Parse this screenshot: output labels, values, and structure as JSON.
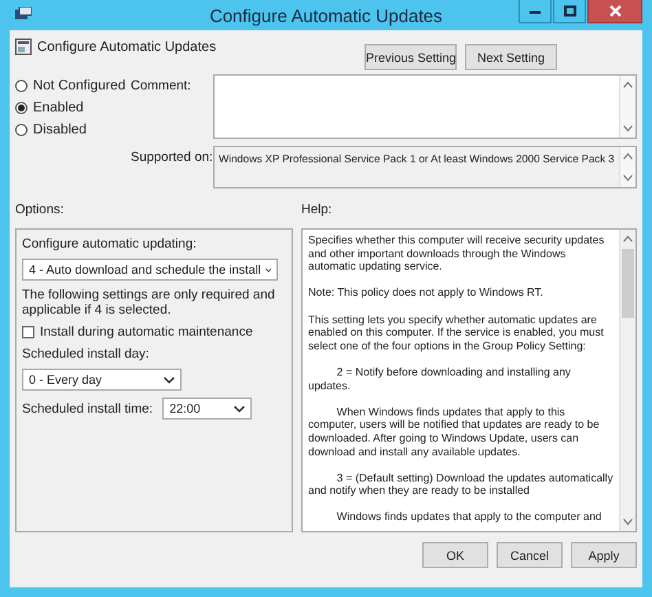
{
  "window": {
    "title": "Configure Automatic Updates"
  },
  "header": {
    "title": "Configure Automatic Updates"
  },
  "nav_buttons": [
    {
      "label": "Previous Setting"
    },
    {
      "label": "Next Setting"
    }
  ],
  "state_options": [
    {
      "label": "Not Configured",
      "selected": false
    },
    {
      "label": "Enabled",
      "selected": true
    },
    {
      "label": "Disabled",
      "selected": false
    }
  ],
  "comment": {
    "label": "Comment:"
  },
  "supported_on": {
    "label": "Supported on:",
    "value": "Windows XP Professional Service Pack 1 or At least Windows 2000 Service Pack 3"
  },
  "options": {
    "label": "Options:",
    "items": [
      {
        "kind": "label",
        "text": "Configure automatic updating:"
      },
      {
        "kind": "dropdown",
        "value": "4 - Auto download and schedule the install"
      },
      {
        "kind": "note",
        "text": "The following settings are only required and applicable if 4 is selected."
      },
      {
        "kind": "checkbox",
        "text": "Install during automatic maintenance",
        "checked": false
      },
      {
        "kind": "label",
        "text": "Scheduled install day:"
      },
      {
        "kind": "dropdown",
        "value": "0 - Every day"
      },
      {
        "kind": "inline_dropdown",
        "text": "Scheduled install time:",
        "value": "22:00"
      }
    ]
  },
  "help": {
    "label": "Help:",
    "paragraphs": [
      {
        "kind": "plain",
        "text": "Specifies whether this computer will receive security updates and other important downloads through the Windows automatic updating service."
      },
      {
        "kind": "plain",
        "text": "Note: This policy does not apply to Windows RT."
      },
      {
        "kind": "plain",
        "text": "This setting lets you specify whether automatic updates are enabled on this computer. If the service is enabled, you must select one of the four options in the Group Policy Setting:"
      },
      {
        "kind": "indent",
        "text": "2 = Notify before downloading and installing any updates."
      },
      {
        "kind": "indent",
        "text": "When Windows finds updates that apply to this computer, users will be notified that updates are ready to be downloaded. After going to Windows Update, users can download and install any available updates."
      },
      {
        "kind": "indent",
        "text": "3 = (Default setting) Download the updates automatically and notify when they are ready to be installed"
      },
      {
        "kind": "indent",
        "text": "Windows finds updates that apply to the computer and"
      }
    ]
  },
  "buttons": [
    {
      "label": "OK"
    },
    {
      "label": "Cancel"
    },
    {
      "label": "Apply"
    }
  ]
}
